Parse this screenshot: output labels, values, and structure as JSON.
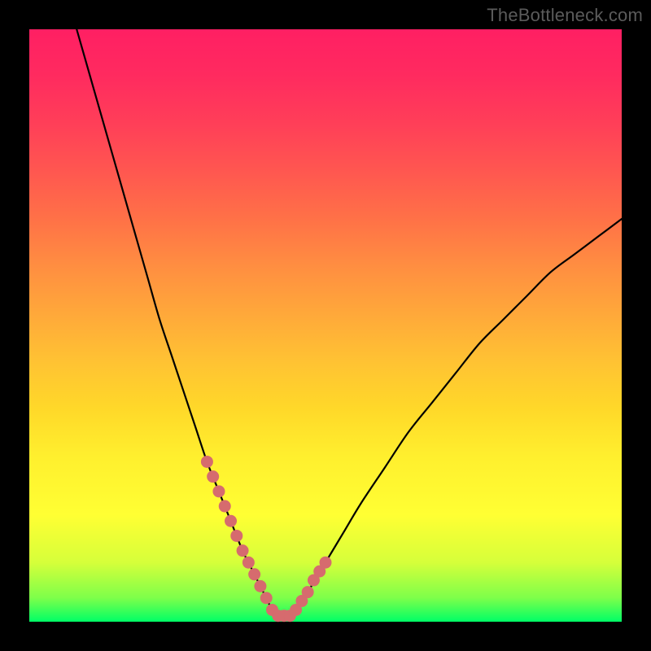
{
  "watermark": "TheBottleneck.com",
  "colors": {
    "frame_bg": "#000000",
    "curve_stroke": "#000000",
    "marker_fill": "#d66b6e",
    "gradient_stops": [
      "#00ff66",
      "#7dff4a",
      "#d6ff3a",
      "#ffff33",
      "#ffef2e",
      "#ffd829",
      "#ffc233",
      "#ffa83a",
      "#ff8e41",
      "#ff7147",
      "#ff5750",
      "#ff3f58",
      "#ff2b5f",
      "#ff1f63"
    ]
  },
  "chart_data": {
    "type": "line",
    "title": "",
    "xlabel": "",
    "ylabel": "",
    "xlim": [
      0,
      100
    ],
    "ylim": [
      0,
      100
    ],
    "grid": false,
    "legend": false,
    "series": [
      {
        "name": "curve",
        "x": [
          8,
          10,
          12,
          14,
          16,
          18,
          20,
          22,
          24,
          26,
          28,
          30,
          32,
          34,
          36,
          37,
          38,
          39,
          40,
          41,
          42,
          43,
          44,
          45,
          47,
          50,
          53,
          56,
          60,
          64,
          68,
          72,
          76,
          80,
          84,
          88,
          92,
          96,
          100
        ],
        "y": [
          100,
          93,
          86,
          79,
          72,
          65,
          58,
          51,
          45,
          39,
          33,
          27,
          22,
          17,
          12,
          10,
          8,
          6,
          4,
          2,
          1,
          1,
          1,
          2,
          5,
          10,
          15,
          20,
          26,
          32,
          37,
          42,
          47,
          51,
          55,
          59,
          62,
          65,
          68
        ]
      }
    ],
    "markers": {
      "name": "highlighted-points",
      "x": [
        30,
        31,
        32,
        33,
        34,
        35,
        36,
        37,
        38,
        39,
        40,
        41,
        42,
        43,
        44,
        45,
        46,
        47,
        48,
        49,
        50
      ],
      "y": [
        27,
        24.5,
        22,
        19.5,
        17,
        14.5,
        12,
        10,
        8,
        6,
        4,
        2,
        1,
        1,
        1,
        2,
        3.5,
        5,
        7,
        8.5,
        10
      ]
    },
    "annotations": []
  }
}
